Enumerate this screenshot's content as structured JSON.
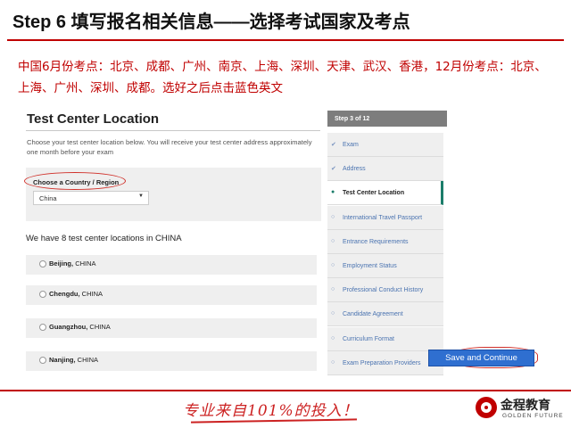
{
  "slide": {
    "title": "Step 6 填写报名相关信息——选择考试国家及考点",
    "notice": "中国6月份考点：北京、成都、广州、南京、上海、深圳、天津、武汉、香港，12月份考点：北京、上海、广州、深圳、成都。选好之后点击蓝色英文"
  },
  "form": {
    "title": "Test Center Location",
    "description": "Choose your test center location below. You will receive your test center address approximately one month before your exam",
    "country_label": "Choose a Country / Region",
    "country_value": "China",
    "location_count": "We have 8 test center locations in CHINA",
    "locations": [
      {
        "city": "Beijing",
        "country": "CHINA"
      },
      {
        "city": "Chengdu",
        "country": "CHINA"
      },
      {
        "city": "Guangzhou",
        "country": "CHINA"
      },
      {
        "city": "Nanjing",
        "country": "CHINA"
      }
    ]
  },
  "steps": {
    "header": "Step 3 of 12",
    "items": [
      {
        "label": "Exam",
        "state": "done"
      },
      {
        "label": "Address",
        "state": "done"
      },
      {
        "label": "Test Center Location",
        "state": "current"
      },
      {
        "label": "International Travel Passport",
        "state": "todo"
      },
      {
        "label": "Entrance Requirements",
        "state": "todo"
      },
      {
        "label": "Employment Status",
        "state": "todo"
      },
      {
        "label": "Professional Conduct History",
        "state": "todo"
      },
      {
        "label": "Candidate Agreement",
        "state": "todo"
      },
      {
        "label": "Curriculum Format",
        "state": "todo"
      },
      {
        "label": "Exam Preparation Providers",
        "state": "todo"
      }
    ]
  },
  "actions": {
    "save_continue": "Save and Continue"
  },
  "footer": {
    "slogan": "专业来自101%的投入！",
    "logo_cn": "金程教育",
    "logo_en": "GOLDEN FUTURE"
  },
  "icons": {
    "done": "check-icon",
    "current": "dot-icon",
    "todo": "circle-icon"
  },
  "colors": {
    "accent_red": "#c00000",
    "button_blue": "#2f6fd0",
    "current_step_green": "#1b7d6a"
  }
}
